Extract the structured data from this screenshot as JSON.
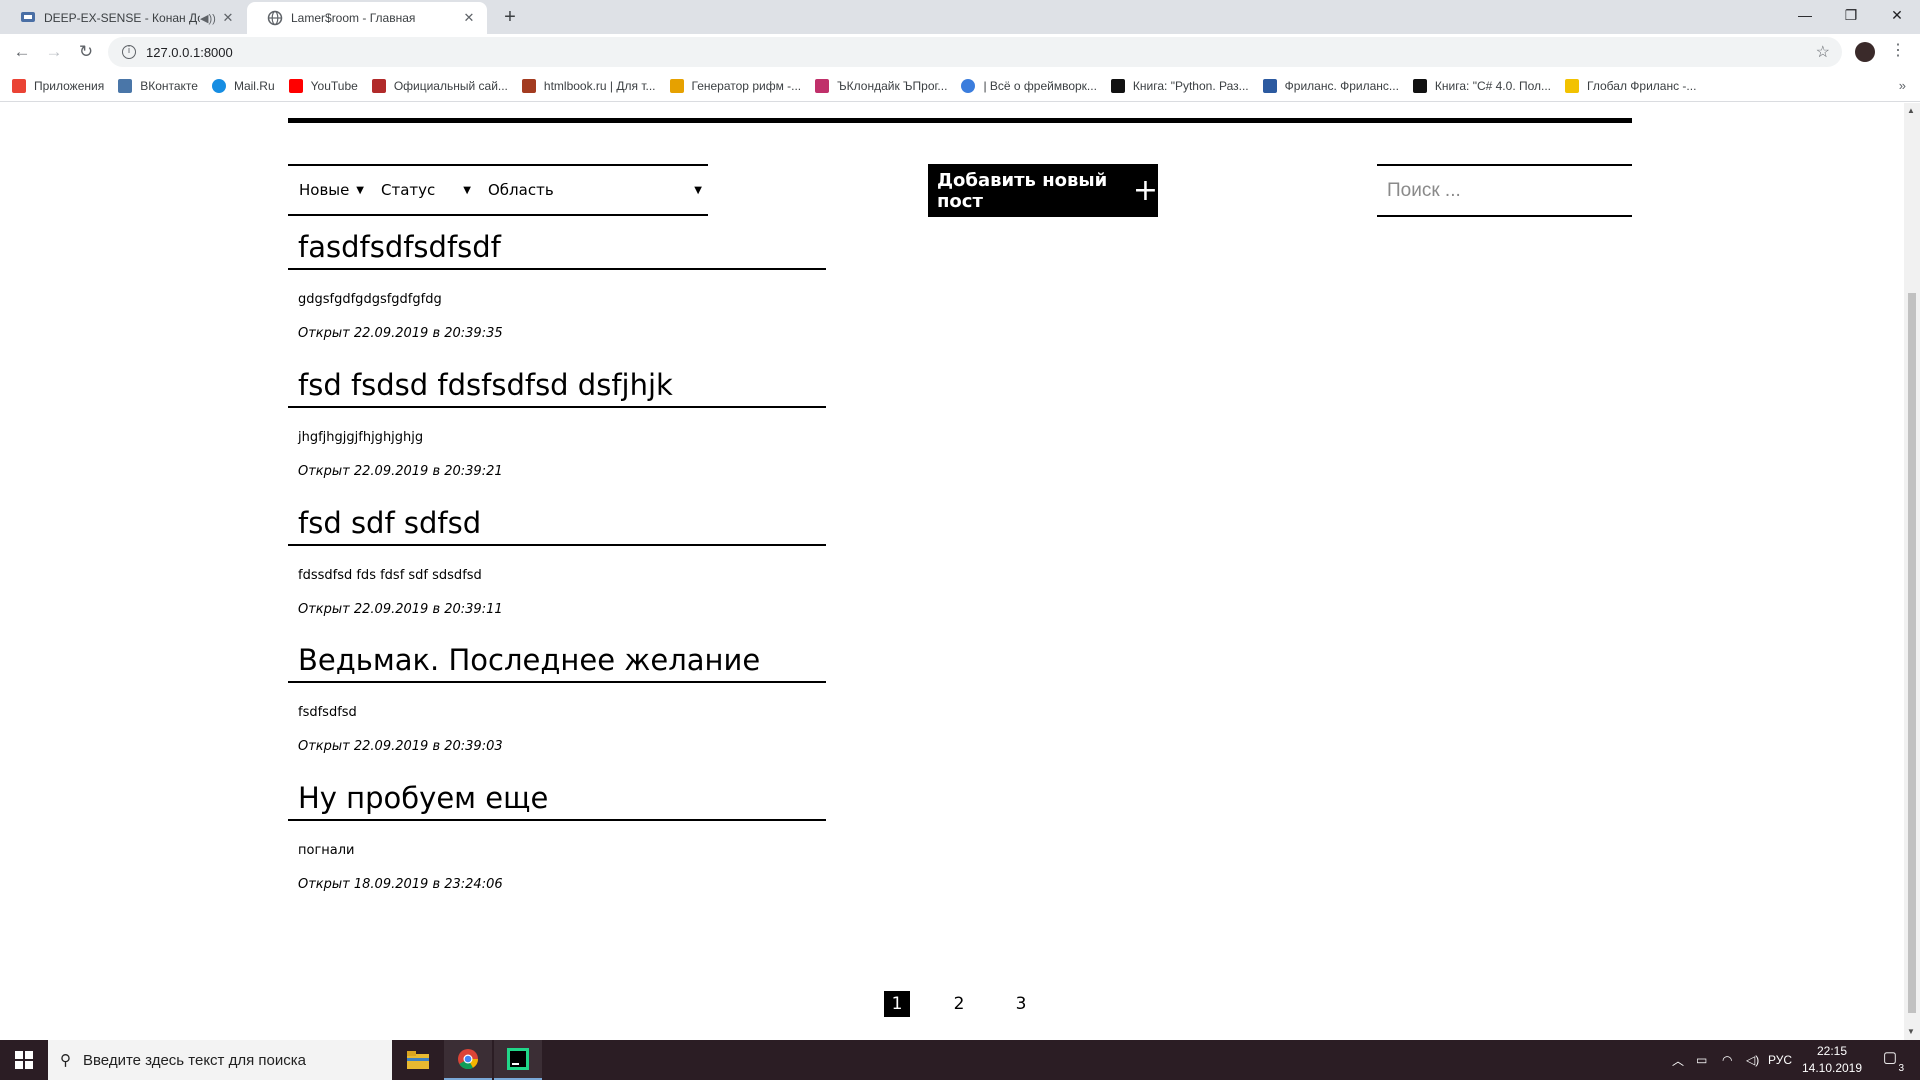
{
  "browser": {
    "tabs": [
      {
        "title": "DEEP-EX-SENSE - Конан Дойл",
        "active": false,
        "audio": true
      },
      {
        "title": "Lamer$room - Главная",
        "active": true,
        "audio": false
      }
    ],
    "new_tab": "+",
    "url": "127.0.0.1:8000",
    "bookmarks": [
      {
        "label": "Приложения",
        "icon": "apps-grid-icon",
        "color": "#ea4335"
      },
      {
        "label": "ВКонтакте",
        "icon": "vk-icon",
        "color": "#4a76a8"
      },
      {
        "label": "Mail.Ru",
        "icon": "mailru-icon",
        "color": "#168de2"
      },
      {
        "label": "YouTube",
        "icon": "youtube-icon",
        "color": "#ff0000"
      },
      {
        "label": "Официальный сай...",
        "icon": "shield-icon",
        "color": "#b12a2a"
      },
      {
        "label": "htmlbook.ru | Для т...",
        "icon": "htmlbook-icon",
        "color": "#a33b20"
      },
      {
        "label": "Генератор рифм -...",
        "icon": "pen-icon",
        "color": "#e6a100"
      },
      {
        "label": "ЪКлондайк ЪПрог...",
        "icon": "gem-icon",
        "color": "#c0306a"
      },
      {
        "label": "| Всё о фреймворк...",
        "icon": "django-icon",
        "color": "#3b7ddd"
      },
      {
        "label": "Книга: \"Python. Раз...",
        "icon": "book-icon",
        "color": "#111111"
      },
      {
        "label": "Фриланс. Фриланс...",
        "icon": "w-icon",
        "color": "#2c5aa0"
      },
      {
        "label": "Книга: \"C# 4.0. Пол...",
        "icon": "book-icon",
        "color": "#111111"
      },
      {
        "label": "Глобал Фриланс -...",
        "icon": "folder-icon",
        "color": "#f2c200"
      }
    ],
    "more": "»"
  },
  "page": {
    "filters": [
      {
        "label": "Новые"
      },
      {
        "label": "Статус"
      },
      {
        "label": "Область"
      }
    ],
    "filter_caret": "▼",
    "add_button": {
      "label": "Добавить новый пост",
      "icon": "plus-icon",
      "glyph": "+"
    },
    "search": {
      "placeholder": "Поиск ..."
    },
    "posts": [
      {
        "title": "fasdfsdfsdfsdf",
        "body": "gdgsfgdfgdgsfgdfgfdg",
        "date": "Открыт 22.09.2019 в 20:39:35"
      },
      {
        "title": "fsd fsdsd fdsfsdfsd dsfjhjk",
        "body": "jhgfjhgjgjfhjghjghjg",
        "date": "Открыт 22.09.2019 в 20:39:21"
      },
      {
        "title": "fsd sdf sdfsd",
        "body": "fdssdfsd fds fdsf sdf sdsdfsd",
        "date": "Открыт 22.09.2019 в 20:39:11"
      },
      {
        "title": "Ведьмак. Последнее желание",
        "body": "fsdfsdfsd",
        "date": "Открыт 22.09.2019 в 20:39:03"
      },
      {
        "title": "Ну пробуем еще",
        "body": "погнали",
        "date": "Открыт 18.09.2019 в 23:24:06"
      }
    ],
    "pagination": {
      "pages": [
        "1",
        "2",
        "3"
      ],
      "current": "1"
    }
  },
  "taskbar": {
    "search_placeholder": "Введите здесь текст для поиска",
    "language": "РУС",
    "time": "22:15",
    "date": "14.10.2019",
    "notification_count": "3"
  }
}
